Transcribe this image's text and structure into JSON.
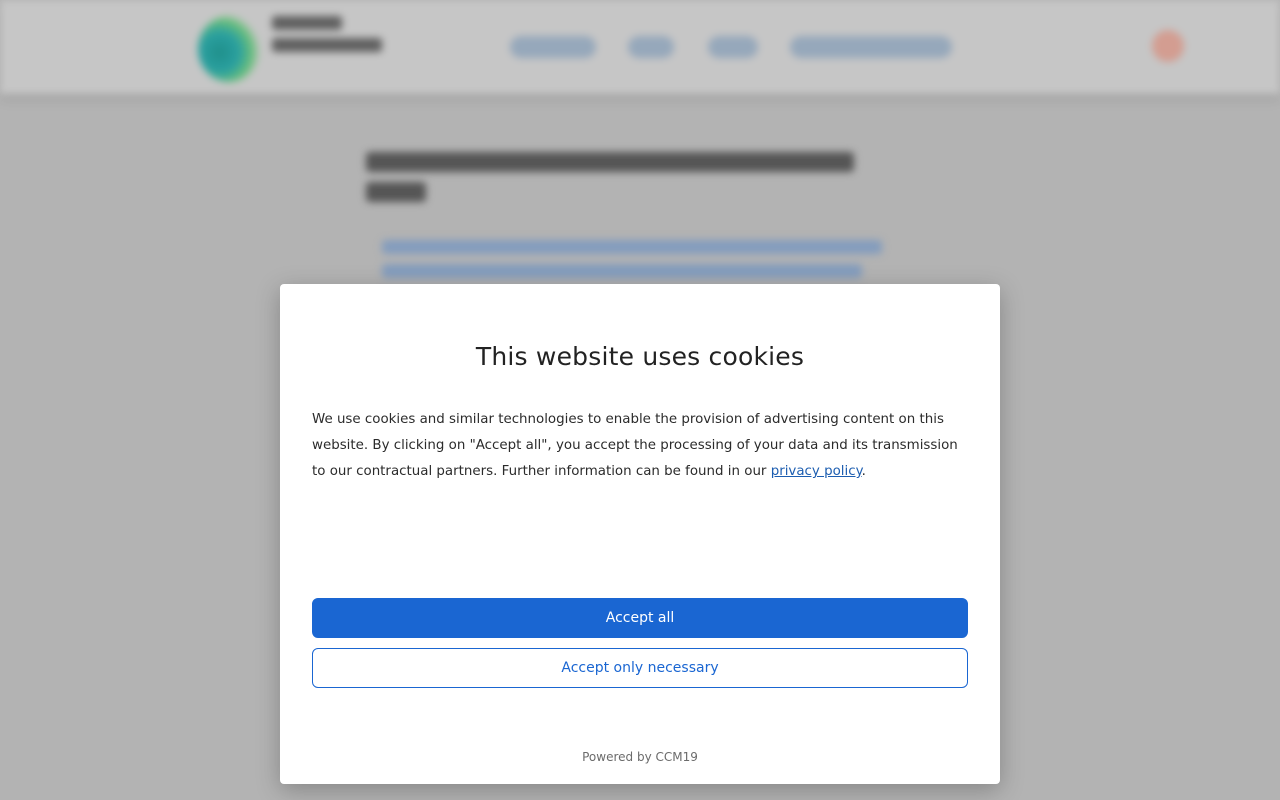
{
  "dialog": {
    "title": "This website uses cookies",
    "body_text": "We use cookies and similar technologies to enable the provision of advertising content on this website. By clicking on \"Accept all\", you accept the processing of your data and its transmission to our contractual partners. Further information can be found in our ",
    "privacy_link": "privacy policy",
    "body_end": ".",
    "accept_all_label": "Accept all",
    "accept_necessary_label": "Accept only necessary",
    "powered_by": "Powered by CCM19"
  },
  "colors": {
    "accent": "#1a66d2",
    "link": "#1c5db0",
    "overlay": "#b3b3b3"
  },
  "icons": {
    "header_right": "user-icon",
    "logo": "logo-mark"
  }
}
